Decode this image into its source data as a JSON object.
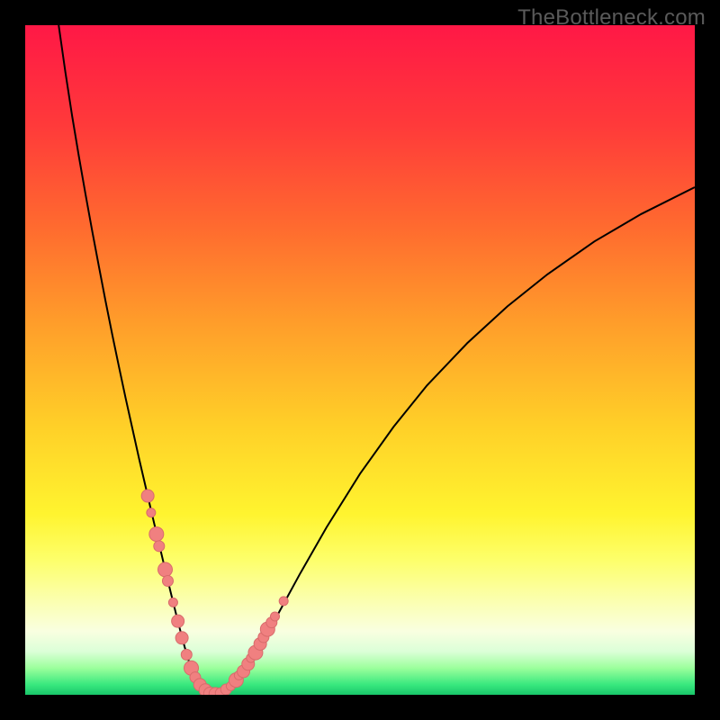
{
  "watermark": "TheBottleneck.com",
  "chart_data": {
    "type": "line",
    "title": "",
    "xlabel": "",
    "ylabel": "",
    "xlim": [
      0,
      100
    ],
    "ylim": [
      0,
      100
    ],
    "grid": false,
    "background_gradient": {
      "stops": [
        {
          "pos": 0.0,
          "color": "#ff1846"
        },
        {
          "pos": 0.15,
          "color": "#ff3a3a"
        },
        {
          "pos": 0.3,
          "color": "#ff6a2f"
        },
        {
          "pos": 0.45,
          "color": "#ff9f2a"
        },
        {
          "pos": 0.6,
          "color": "#ffd028"
        },
        {
          "pos": 0.73,
          "color": "#fff42f"
        },
        {
          "pos": 0.8,
          "color": "#fdff6c"
        },
        {
          "pos": 0.86,
          "color": "#fbffb0"
        },
        {
          "pos": 0.905,
          "color": "#f9ffe0"
        },
        {
          "pos": 0.935,
          "color": "#dcffd8"
        },
        {
          "pos": 0.96,
          "color": "#9cff9c"
        },
        {
          "pos": 0.985,
          "color": "#38e87e"
        },
        {
          "pos": 1.0,
          "color": "#19c66a"
        }
      ]
    },
    "series": [
      {
        "name": "bottleneck-curve",
        "color": "#000000",
        "width": 2,
        "x": [
          5.0,
          6.0,
          7.0,
          8.0,
          9.0,
          10.0,
          11.0,
          12.0,
          13.0,
          14.0,
          15.0,
          16.0,
          17.0,
          18.0,
          19.0,
          20.0,
          21.0,
          22.0,
          23.0,
          23.8,
          24.5,
          25.2,
          26.0,
          27.0,
          28.0,
          29.5,
          31.0,
          33.0,
          35.0,
          38.0,
          41.0,
          45.0,
          50.0,
          55.0,
          60.0,
          66.0,
          72.0,
          78.0,
          85.0,
          92.0,
          100.0
        ],
        "y": [
          100.0,
          93.0,
          86.5,
          80.5,
          74.8,
          69.3,
          64.0,
          58.8,
          53.8,
          49.0,
          44.3,
          39.8,
          35.3,
          31.0,
          26.7,
          22.5,
          18.3,
          14.2,
          10.2,
          7.2,
          4.8,
          3.0,
          1.6,
          0.6,
          0.1,
          0.3,
          1.4,
          3.8,
          7.0,
          12.5,
          18.0,
          25.0,
          33.0,
          40.0,
          46.2,
          52.5,
          58.0,
          62.8,
          67.7,
          71.8,
          75.8
        ]
      }
    ],
    "markers": {
      "name": "sample-markers",
      "color": "#f08080",
      "stroke": "#d86b6b",
      "radius_min": 4.5,
      "radius_max": 9,
      "points": [
        {
          "x": 18.3,
          "y": 29.7,
          "r": 7
        },
        {
          "x": 18.8,
          "y": 27.2,
          "r": 5
        },
        {
          "x": 19.6,
          "y": 24.0,
          "r": 8
        },
        {
          "x": 20.0,
          "y": 22.2,
          "r": 6
        },
        {
          "x": 20.9,
          "y": 18.7,
          "r": 8
        },
        {
          "x": 21.3,
          "y": 17.0,
          "r": 6
        },
        {
          "x": 22.1,
          "y": 13.8,
          "r": 5
        },
        {
          "x": 22.8,
          "y": 11.0,
          "r": 7
        },
        {
          "x": 23.4,
          "y": 8.5,
          "r": 7
        },
        {
          "x": 24.1,
          "y": 6.0,
          "r": 6
        },
        {
          "x": 24.8,
          "y": 4.0,
          "r": 8
        },
        {
          "x": 25.4,
          "y": 2.6,
          "r": 6
        },
        {
          "x": 26.1,
          "y": 1.5,
          "r": 7
        },
        {
          "x": 26.9,
          "y": 0.7,
          "r": 7
        },
        {
          "x": 27.6,
          "y": 0.2,
          "r": 7
        },
        {
          "x": 28.4,
          "y": 0.15,
          "r": 7
        },
        {
          "x": 29.2,
          "y": 0.25,
          "r": 6
        },
        {
          "x": 30.0,
          "y": 0.8,
          "r": 6
        },
        {
          "x": 30.7,
          "y": 1.3,
          "r": 5
        },
        {
          "x": 31.5,
          "y": 2.2,
          "r": 8
        },
        {
          "x": 31.9,
          "y": 2.9,
          "r": 5
        },
        {
          "x": 32.6,
          "y": 3.5,
          "r": 7
        },
        {
          "x": 33.3,
          "y": 4.6,
          "r": 7
        },
        {
          "x": 33.7,
          "y": 5.5,
          "r": 5
        },
        {
          "x": 34.4,
          "y": 6.3,
          "r": 8
        },
        {
          "x": 35.1,
          "y": 7.6,
          "r": 7
        },
        {
          "x": 35.6,
          "y": 8.6,
          "r": 6
        },
        {
          "x": 36.2,
          "y": 9.8,
          "r": 8
        },
        {
          "x": 36.8,
          "y": 10.8,
          "r": 6
        },
        {
          "x": 37.3,
          "y": 11.7,
          "r": 5
        },
        {
          "x": 38.6,
          "y": 14.0,
          "r": 5
        }
      ]
    }
  }
}
